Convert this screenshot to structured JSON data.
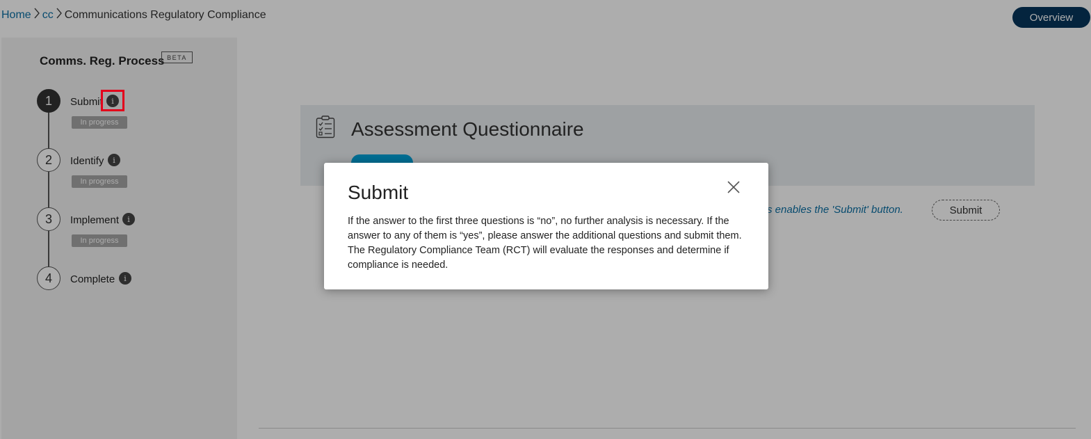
{
  "breadcrumb": {
    "home": "Home",
    "section": "cc",
    "current": "Communications Regulatory Compliance"
  },
  "header": {
    "overview_label": "Overview"
  },
  "sidebar": {
    "title": "Comms. Reg. Process",
    "beta": "BETA",
    "steps": [
      {
        "number": "1",
        "label": "Submit",
        "status": "In progress",
        "active": true
      },
      {
        "number": "2",
        "label": "Identify",
        "status": "In progress"
      },
      {
        "number": "3",
        "label": "Implement",
        "status": "In progress"
      },
      {
        "number": "4",
        "label": "Complete"
      }
    ],
    "info_glyph": "i"
  },
  "main": {
    "card_title": "Assessment Questionnaire",
    "card_icon": "clipboard-checklist-icon",
    "hint": "s enables the 'Submit' button.",
    "submit_label": "Submit"
  },
  "modal": {
    "title": "Submit",
    "body": "If the answer to the first three questions is “no”, no further analysis is necessary. If the answer to any of them is “yes”, please answer the additional questions and submit them. The Regulatory Compliance Team (RCT) will evaluate the responses and determine if compliance is needed.",
    "close_icon": "close-icon"
  },
  "colors": {
    "overview_bg": "#06365c",
    "link": "#0b6fa4",
    "review_pill": "#00a3d9",
    "highlight": "#e3001b"
  }
}
